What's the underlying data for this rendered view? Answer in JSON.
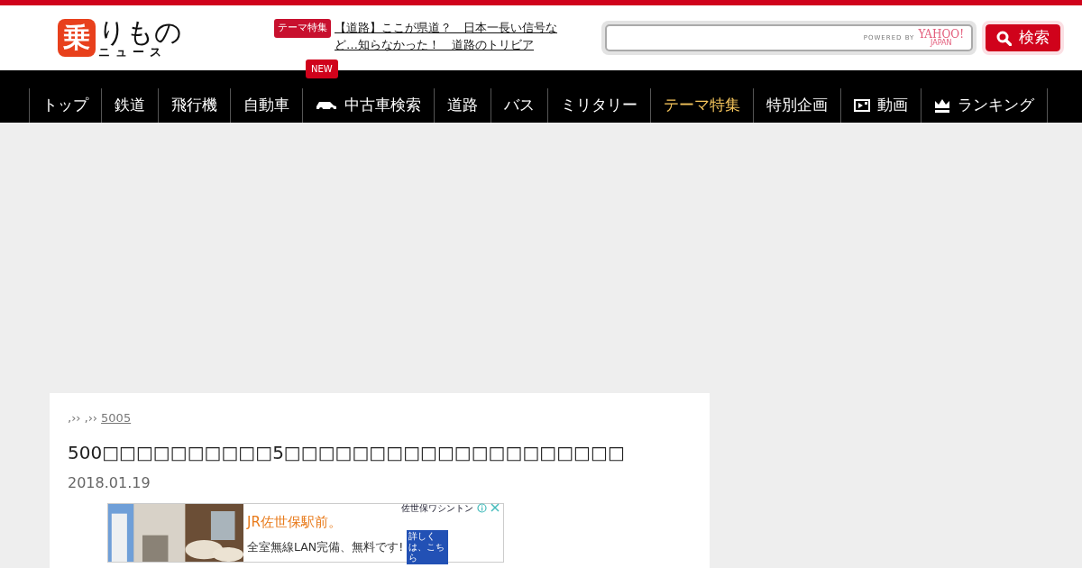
{
  "logo": {
    "mark": "乗",
    "main": "りもの",
    "sub": "ニュース"
  },
  "headline": {
    "tag": "テーマ特集",
    "text": "【道路】ここが県道？　日本一長い信号など…知らなかった！　道路のトリビア"
  },
  "new_badge": "NEW",
  "search": {
    "powered": "POWERED BY",
    "brand": "YAHOO!",
    "brand_sub": "JAPAN",
    "button": "検索"
  },
  "nav": [
    {
      "label": "トップ",
      "selected": false
    },
    {
      "label": "鉄道",
      "selected": false
    },
    {
      "label": "飛行機",
      "selected": false
    },
    {
      "label": "自動車",
      "selected": false
    },
    {
      "label": "中古車検索",
      "selected": false,
      "kind": "car"
    },
    {
      "label": "道路",
      "selected": false
    },
    {
      "label": "バス",
      "selected": false
    },
    {
      "label": "ミリタリー",
      "selected": false
    },
    {
      "label": "テーマ特集",
      "selected": true
    },
    {
      "label": "特別企画",
      "selected": false
    },
    {
      "label": "動画",
      "selected": false,
      "kind": "video"
    },
    {
      "label": "ランキング",
      "selected": false,
      "kind": "crown"
    }
  ],
  "breadcrumb": [
    {
      "text": "‚››",
      "link": false
    },
    {
      "text": "‚››",
      "link": false
    },
    {
      "text": "5005",
      "link": true
    }
  ],
  "article": {
    "title": "500□□□□□□□□□□5□□□□□□□□□□□□□□□□□□□□",
    "date": "2018.01.19"
  },
  "ad": {
    "brand": "佐世保ワシントン",
    "line1": "JR佐世保駅前。",
    "line2": "全室無線LAN完備、無料です!",
    "more": "詳しくは、こちら"
  }
}
